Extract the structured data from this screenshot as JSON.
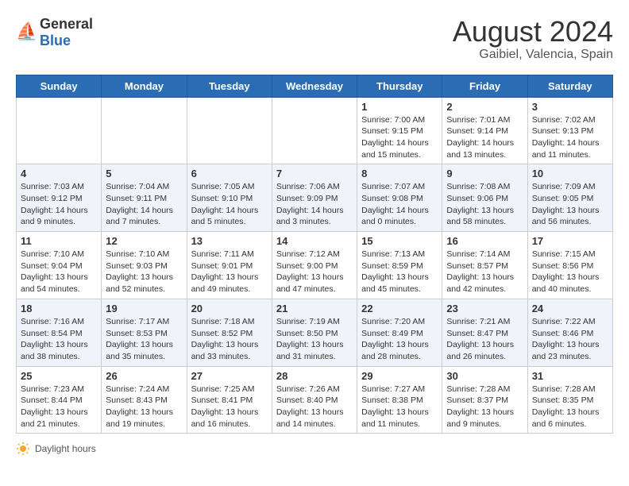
{
  "header": {
    "logo_general": "General",
    "logo_blue": "Blue",
    "month_title": "August 2024",
    "location": "Gaibiel, Valencia, Spain"
  },
  "days_of_week": [
    "Sunday",
    "Monday",
    "Tuesday",
    "Wednesday",
    "Thursday",
    "Friday",
    "Saturday"
  ],
  "weeks": [
    [
      {
        "day": "",
        "info": ""
      },
      {
        "day": "",
        "info": ""
      },
      {
        "day": "",
        "info": ""
      },
      {
        "day": "",
        "info": ""
      },
      {
        "day": "1",
        "info": "Sunrise: 7:00 AM\nSunset: 9:15 PM\nDaylight: 14 hours\nand 15 minutes."
      },
      {
        "day": "2",
        "info": "Sunrise: 7:01 AM\nSunset: 9:14 PM\nDaylight: 14 hours\nand 13 minutes."
      },
      {
        "day": "3",
        "info": "Sunrise: 7:02 AM\nSunset: 9:13 PM\nDaylight: 14 hours\nand 11 minutes."
      }
    ],
    [
      {
        "day": "4",
        "info": "Sunrise: 7:03 AM\nSunset: 9:12 PM\nDaylight: 14 hours\nand 9 minutes."
      },
      {
        "day": "5",
        "info": "Sunrise: 7:04 AM\nSunset: 9:11 PM\nDaylight: 14 hours\nand 7 minutes."
      },
      {
        "day": "6",
        "info": "Sunrise: 7:05 AM\nSunset: 9:10 PM\nDaylight: 14 hours\nand 5 minutes."
      },
      {
        "day": "7",
        "info": "Sunrise: 7:06 AM\nSunset: 9:09 PM\nDaylight: 14 hours\nand 3 minutes."
      },
      {
        "day": "8",
        "info": "Sunrise: 7:07 AM\nSunset: 9:08 PM\nDaylight: 14 hours\nand 0 minutes."
      },
      {
        "day": "9",
        "info": "Sunrise: 7:08 AM\nSunset: 9:06 PM\nDaylight: 13 hours\nand 58 minutes."
      },
      {
        "day": "10",
        "info": "Sunrise: 7:09 AM\nSunset: 9:05 PM\nDaylight: 13 hours\nand 56 minutes."
      }
    ],
    [
      {
        "day": "11",
        "info": "Sunrise: 7:10 AM\nSunset: 9:04 PM\nDaylight: 13 hours\nand 54 minutes."
      },
      {
        "day": "12",
        "info": "Sunrise: 7:10 AM\nSunset: 9:03 PM\nDaylight: 13 hours\nand 52 minutes."
      },
      {
        "day": "13",
        "info": "Sunrise: 7:11 AM\nSunset: 9:01 PM\nDaylight: 13 hours\nand 49 minutes."
      },
      {
        "day": "14",
        "info": "Sunrise: 7:12 AM\nSunset: 9:00 PM\nDaylight: 13 hours\nand 47 minutes."
      },
      {
        "day": "15",
        "info": "Sunrise: 7:13 AM\nSunset: 8:59 PM\nDaylight: 13 hours\nand 45 minutes."
      },
      {
        "day": "16",
        "info": "Sunrise: 7:14 AM\nSunset: 8:57 PM\nDaylight: 13 hours\nand 42 minutes."
      },
      {
        "day": "17",
        "info": "Sunrise: 7:15 AM\nSunset: 8:56 PM\nDaylight: 13 hours\nand 40 minutes."
      }
    ],
    [
      {
        "day": "18",
        "info": "Sunrise: 7:16 AM\nSunset: 8:54 PM\nDaylight: 13 hours\nand 38 minutes."
      },
      {
        "day": "19",
        "info": "Sunrise: 7:17 AM\nSunset: 8:53 PM\nDaylight: 13 hours\nand 35 minutes."
      },
      {
        "day": "20",
        "info": "Sunrise: 7:18 AM\nSunset: 8:52 PM\nDaylight: 13 hours\nand 33 minutes."
      },
      {
        "day": "21",
        "info": "Sunrise: 7:19 AM\nSunset: 8:50 PM\nDaylight: 13 hours\nand 31 minutes."
      },
      {
        "day": "22",
        "info": "Sunrise: 7:20 AM\nSunset: 8:49 PM\nDaylight: 13 hours\nand 28 minutes."
      },
      {
        "day": "23",
        "info": "Sunrise: 7:21 AM\nSunset: 8:47 PM\nDaylight: 13 hours\nand 26 minutes."
      },
      {
        "day": "24",
        "info": "Sunrise: 7:22 AM\nSunset: 8:46 PM\nDaylight: 13 hours\nand 23 minutes."
      }
    ],
    [
      {
        "day": "25",
        "info": "Sunrise: 7:23 AM\nSunset: 8:44 PM\nDaylight: 13 hours\nand 21 minutes."
      },
      {
        "day": "26",
        "info": "Sunrise: 7:24 AM\nSunset: 8:43 PM\nDaylight: 13 hours\nand 19 minutes."
      },
      {
        "day": "27",
        "info": "Sunrise: 7:25 AM\nSunset: 8:41 PM\nDaylight: 13 hours\nand 16 minutes."
      },
      {
        "day": "28",
        "info": "Sunrise: 7:26 AM\nSunset: 8:40 PM\nDaylight: 13 hours\nand 14 minutes."
      },
      {
        "day": "29",
        "info": "Sunrise: 7:27 AM\nSunset: 8:38 PM\nDaylight: 13 hours\nand 11 minutes."
      },
      {
        "day": "30",
        "info": "Sunrise: 7:28 AM\nSunset: 8:37 PM\nDaylight: 13 hours\nand 9 minutes."
      },
      {
        "day": "31",
        "info": "Sunrise: 7:28 AM\nSunset: 8:35 PM\nDaylight: 13 hours\nand 6 minutes."
      }
    ]
  ],
  "footer": {
    "daylight_label": "Daylight hours"
  }
}
